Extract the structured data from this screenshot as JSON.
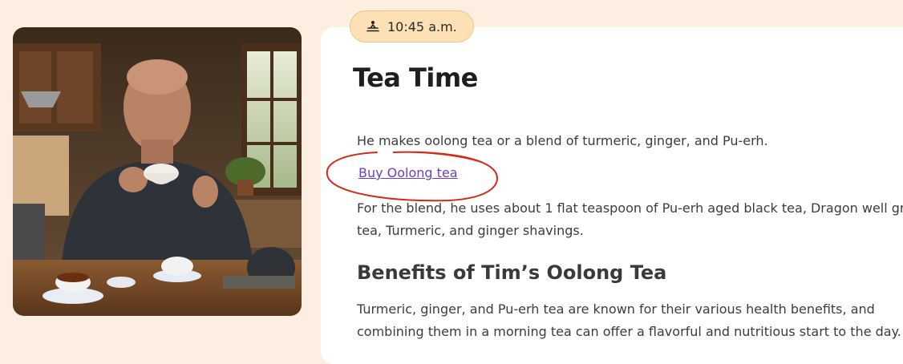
{
  "header": {
    "time": "10:45 a.m.",
    "time_icon": "meditation-icon"
  },
  "article": {
    "title": "Tea Time",
    "intro": "He makes oolong tea or a blend of turmeric, ginger, and Pu-erh.",
    "buy_link": "Buy Oolong tea",
    "blend_line1": "For the blend, he uses about 1 flat teaspoon of Pu-erh aged black tea, Dragon well gr",
    "blend_line2": "tea, Turmeric, and ginger shavings.",
    "benefits_heading": "Benefits of Tim’s Oolong Tea",
    "benefits_line1": "Turmeric, ginger, and Pu-erh tea are known for their various health benefits, and",
    "benefits_line2": "combining them in a morning tea can offer a flavorful and nutritious start to the day."
  },
  "colors": {
    "page_bg": "#fcefe2",
    "badge_bg": "#fde0b4",
    "link": "#6d3fbf",
    "annotation": "#d42a1c"
  }
}
